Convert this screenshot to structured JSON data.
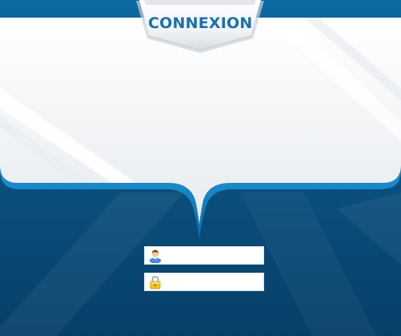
{
  "login": {
    "title": "CONNEXION",
    "username": {
      "value": "",
      "placeholder": "",
      "icon": "user-icon"
    },
    "password": {
      "value": "",
      "placeholder": "",
      "icon": "lock-icon"
    }
  },
  "colors": {
    "title_text": "#1a72a8",
    "panel_top": "#f2f4f6",
    "panel_bottom": "#0a4a78",
    "glow_edge": "#43b4ee"
  }
}
